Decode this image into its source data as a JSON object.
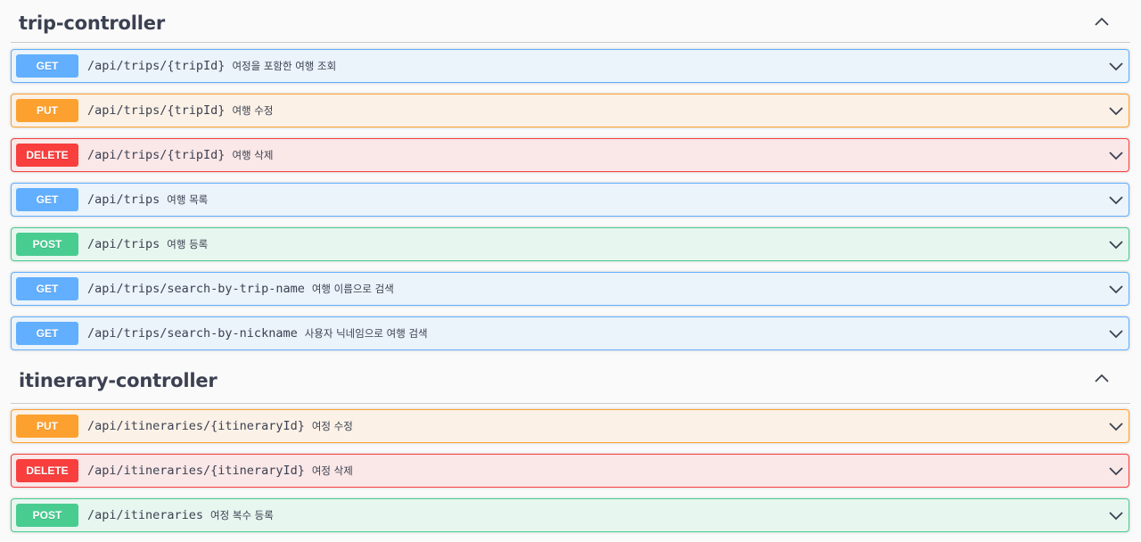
{
  "colors": {
    "get": "#61affe",
    "put": "#fca130",
    "delete": "#f93e3e",
    "post": "#49cc90",
    "text": "#3b4151"
  },
  "sections": [
    {
      "title": "trip-controller",
      "collapse_icon": "chevron-up-icon",
      "operations": [
        {
          "method": "GET",
          "path": "/api/trips/{tripId}",
          "summary": "여정을 포함한 여행 조회"
        },
        {
          "method": "PUT",
          "path": "/api/trips/{tripId}",
          "summary": "여행 수정"
        },
        {
          "method": "DELETE",
          "path": "/api/trips/{tripId}",
          "summary": "여행 삭제"
        },
        {
          "method": "GET",
          "path": "/api/trips",
          "summary": "여행 목록"
        },
        {
          "method": "POST",
          "path": "/api/trips",
          "summary": "여행 등록"
        },
        {
          "method": "GET",
          "path": "/api/trips/search-by-trip-name",
          "summary": "여행 이름으로 검색"
        },
        {
          "method": "GET",
          "path": "/api/trips/search-by-nickname",
          "summary": "사용자 닉네임으로 여행 검색"
        }
      ]
    },
    {
      "title": "itinerary-controller",
      "collapse_icon": "chevron-up-icon",
      "operations": [
        {
          "method": "PUT",
          "path": "/api/itineraries/{itineraryId}",
          "summary": "여정 수정"
        },
        {
          "method": "DELETE",
          "path": "/api/itineraries/{itineraryId}",
          "summary": "여정 삭제"
        },
        {
          "method": "POST",
          "path": "/api/itineraries",
          "summary": "여정 복수 등록"
        }
      ]
    }
  ]
}
